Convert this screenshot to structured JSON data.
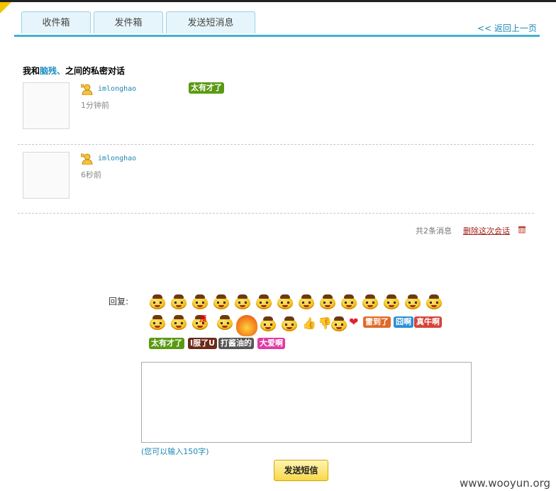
{
  "tabs": [
    {
      "label": "收件箱"
    },
    {
      "label": "发件箱"
    },
    {
      "label": "发送短消息"
    }
  ],
  "back_link": "<< 返回上一页",
  "title": {
    "prefix": "我和",
    "name": "脑残、",
    "suffix": "之间的私密对话"
  },
  "messages": [
    {
      "username": "imlonghao",
      "time": "1分钟前",
      "sticker": "太有才了"
    },
    {
      "username": "imlonghao",
      "time": "6秒前"
    }
  ],
  "summary": {
    "count_text": "共2条消息",
    "delete_label": "删除这次会话"
  },
  "reply": {
    "label": "回复:",
    "stickers": [
      "雷到了",
      "囧啊",
      "真牛啊",
      "太有才了",
      "I服了U",
      "打酱油的",
      "大爱啊"
    ],
    "top_label": "顶",
    "hint": "(您可以输入150字)",
    "send_label": "发送短信"
  },
  "watermark": "www.wooyun.org",
  "colors": {
    "accent": "#3fb3cf",
    "link": "#1f88b5",
    "delete": "#a0211a"
  }
}
